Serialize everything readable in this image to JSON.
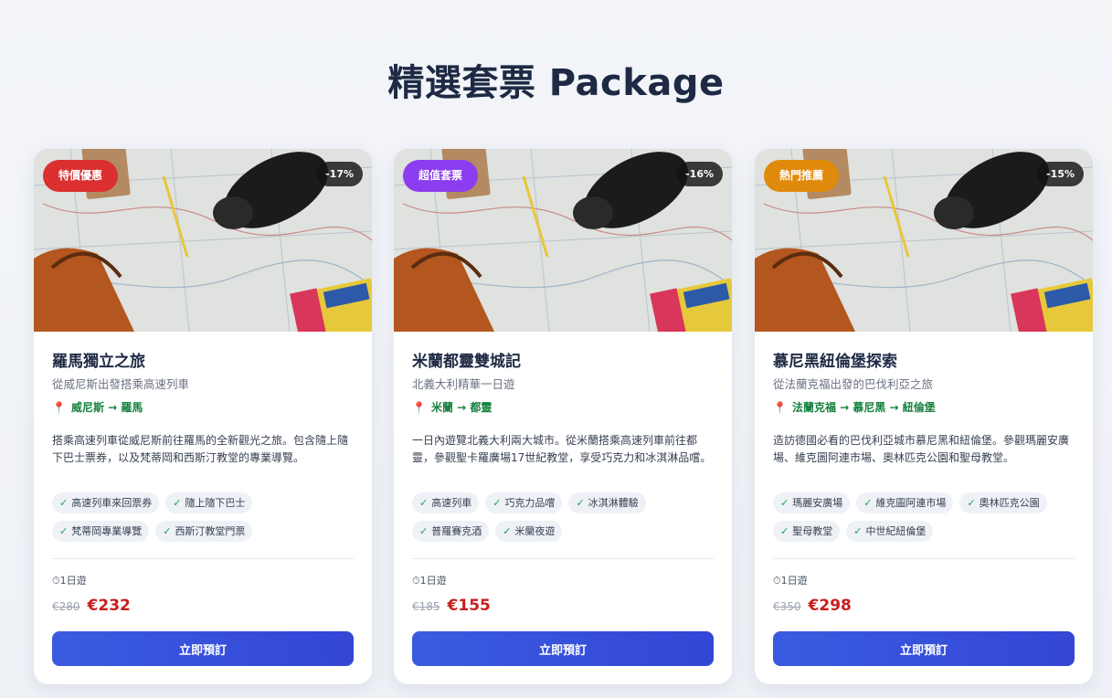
{
  "page": {
    "title": "精選套票 Package"
  },
  "cards": [
    {
      "badge": "特價優惠",
      "badge_color": "#dc2f2f",
      "discount": "-17%",
      "title": "羅馬獨立之旅",
      "subtitle": "從威尼斯出發搭乘高速列車",
      "route": "威尼斯 → 羅馬",
      "description": "搭乘高速列車從威尼斯前往羅馬的全新觀光之旅。包含隨上隨下巴士票券，以及梵蒂岡和西斯汀教堂的專業導覽。",
      "tags": [
        "高速列車來回票券",
        "隨上隨下巴士",
        "梵蒂岡專業導覽",
        "西斯汀教堂門票"
      ],
      "duration": "1日遊",
      "old_price": "€280",
      "price": "€232",
      "button": "立即預訂"
    },
    {
      "badge": "超值套票",
      "badge_color": "#8b3df0",
      "discount": "-16%",
      "title": "米蘭都靈雙城記",
      "subtitle": "北義大利精華一日遊",
      "route": "米蘭 → 都靈",
      "description": "一日內遊覽北義大利兩大城市。從米蘭搭乘高速列車前往都靈，參觀聖卡羅廣場17世紀教堂，享受巧克力和冰淇淋品嚐。",
      "tags": [
        "高速列車",
        "巧克力品嚐",
        "冰淇淋體驗",
        "普羅賽克酒",
        "米蘭夜遊"
      ],
      "duration": "1日遊",
      "old_price": "€185",
      "price": "€155",
      "button": "立即預訂"
    },
    {
      "badge": "熱門推薦",
      "badge_color": "#e08a0b",
      "discount": "-15%",
      "title": "慕尼黑紐倫堡探索",
      "subtitle": "從法蘭克福出發的巴伐利亞之旅",
      "route": "法蘭克福 → 慕尼黑 → 紐倫堡",
      "description": "造訪德國必看的巴伐利亞城市慕尼黑和紐倫堡。參觀瑪麗安廣場、維克圖阿連市場、奧林匹克公園和聖母教堂。",
      "tags": [
        "瑪麗安廣場",
        "維克圖阿連市場",
        "奧林匹克公園",
        "聖母教堂",
        "中世紀紐倫堡"
      ],
      "duration": "1日遊",
      "old_price": "€350",
      "price": "€298",
      "button": "立即預訂"
    }
  ],
  "icons": {
    "pin": "map-pin-icon",
    "check": "check-icon",
    "clock": "clock-icon"
  }
}
